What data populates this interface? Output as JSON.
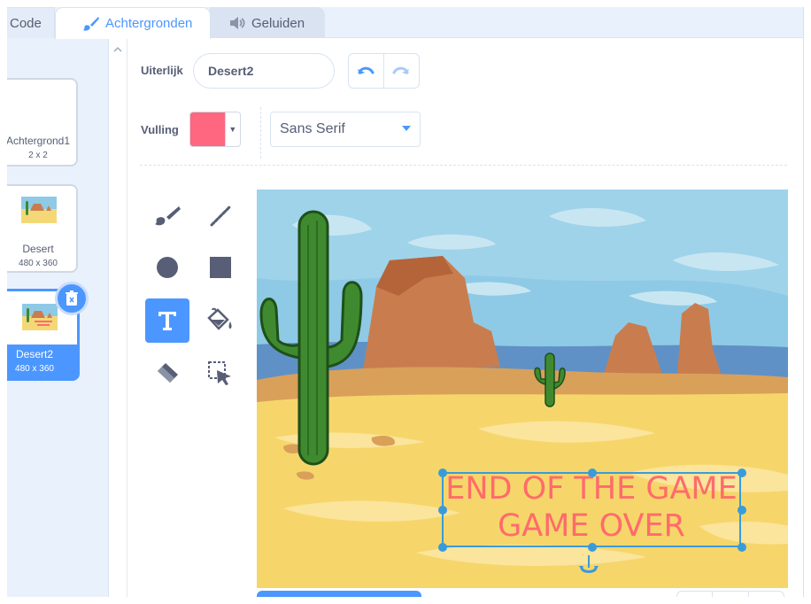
{
  "tabs": [
    {
      "label": "Code"
    },
    {
      "label": "Achtergronden"
    },
    {
      "label": "Geluiden"
    }
  ],
  "backdrops": [
    {
      "name": "Achtergrond1",
      "size": "2 x 2"
    },
    {
      "name": "Desert",
      "size": "480 x 360"
    },
    {
      "name": "Desert2",
      "size": "480 x 360"
    }
  ],
  "editor": {
    "costume_label": "Uiterlijk",
    "costume_name": "Desert2",
    "fill_label": "Vulling",
    "fill_color": "#ff6680",
    "font": "Sans Serif"
  },
  "tools": [
    {
      "icon": "brush-icon"
    },
    {
      "icon": "line-icon"
    },
    {
      "icon": "circle-icon"
    },
    {
      "icon": "rectangle-icon"
    },
    {
      "icon": "text-icon",
      "active": true
    },
    {
      "icon": "fill-icon"
    },
    {
      "icon": "eraser-icon"
    },
    {
      "icon": "select-icon"
    }
  ],
  "canvas": {
    "text_lines": [
      "END OF THE GAME",
      "GAME OVER"
    ],
    "text_color": "#ff6b6b"
  },
  "colors": {
    "accent": "#4c97ff",
    "background": "#e9f1fc",
    "text": "#575e75"
  }
}
